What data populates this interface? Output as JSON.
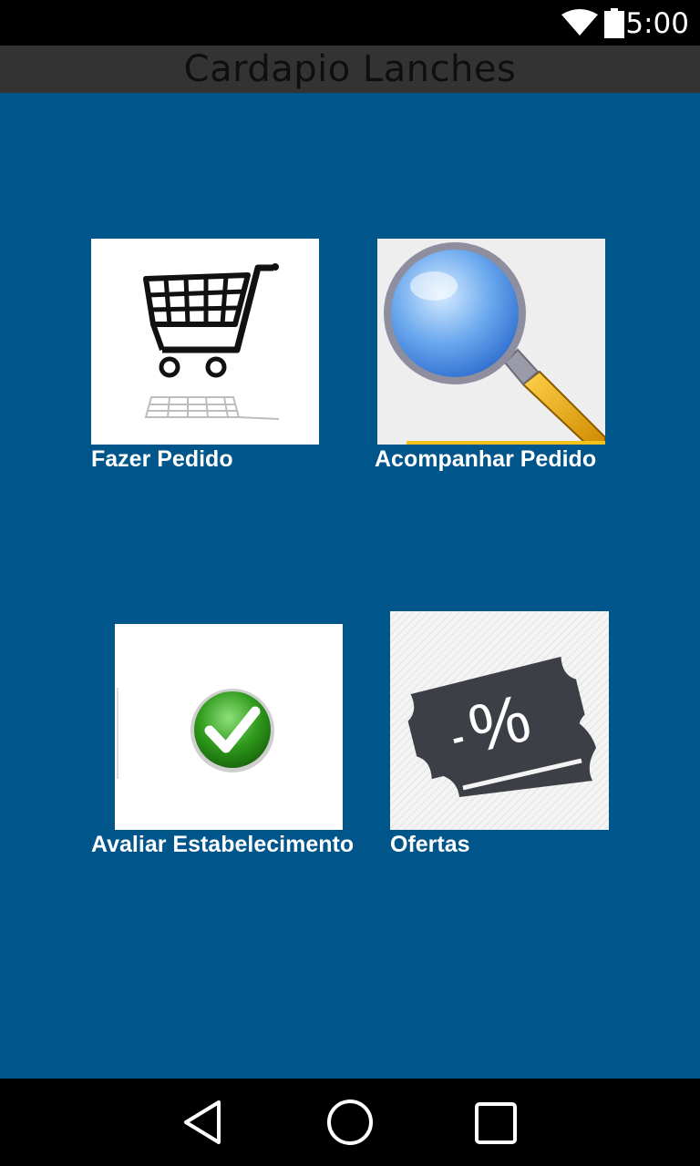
{
  "status_bar": {
    "time": "5:00",
    "icons": [
      "wifi-icon",
      "battery-icon"
    ]
  },
  "header": {
    "title": "Cardapio Lanches"
  },
  "menu": {
    "items": [
      {
        "label": "Fazer Pedido",
        "icon": "shopping-cart-icon"
      },
      {
        "label": "Acompanhar Pedido",
        "icon": "magnifying-glass-icon"
      },
      {
        "label": "Avaliar Estabelecimento",
        "icon": "checkmark-icon"
      },
      {
        "label": "Ofertas",
        "icon": "discount-ticket-icon"
      }
    ]
  },
  "nav_bar": {
    "buttons": [
      "back-icon",
      "home-icon",
      "recents-icon"
    ]
  },
  "colors": {
    "background": "#00558a",
    "title_bar": "#333333",
    "system_bars": "#000000",
    "label": "#ffffff"
  }
}
